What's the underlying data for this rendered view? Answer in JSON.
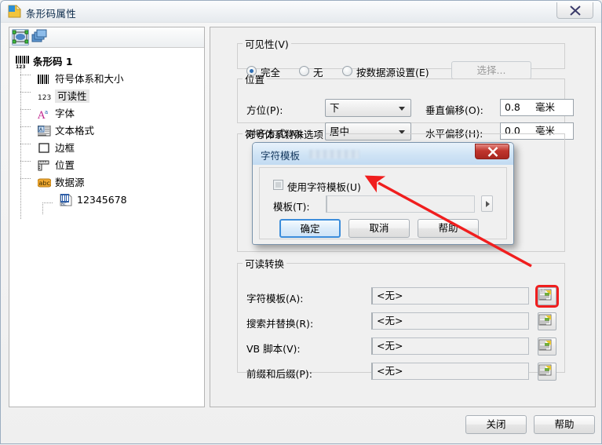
{
  "window": {
    "title": "条形码属性",
    "icon": "document-page-icon",
    "close_label": "×"
  },
  "tree_toolbar": {
    "buttons": [
      {
        "name": "object-select-icon",
        "pressed": true
      },
      {
        "name": "layers-icon",
        "pressed": false
      }
    ]
  },
  "tree": {
    "root": {
      "label": "条形码 1",
      "icon": "barcode-123-icon"
    },
    "items": [
      {
        "label": "符号体系和大小",
        "icon": "barcode-icon"
      },
      {
        "label": "可读性",
        "icon": "digits-123-icon",
        "selected": true
      },
      {
        "label": "字体",
        "icon": "font-a-icon"
      },
      {
        "label": "文本格式",
        "icon": "text-format-icon"
      },
      {
        "label": "边框",
        "icon": "border-square-icon"
      },
      {
        "label": "位置",
        "icon": "ruler-position-icon"
      },
      {
        "label": "数据源",
        "icon": "abc-datasource-icon"
      }
    ],
    "leaf": {
      "label": "12345678",
      "icon": "barcode-data-icon"
    }
  },
  "visibility": {
    "legend": "可见性(V)",
    "options": [
      {
        "label": "完全",
        "selected": true
      },
      {
        "label": "无",
        "selected": false
      },
      {
        "label": "按数据源设置(E)",
        "selected": false
      }
    ],
    "select_button": "选择...",
    "select_button_disabled": true
  },
  "position": {
    "legend": "位置",
    "orientation_label": "方位(P):",
    "orientation_value": "下",
    "align_label": "对齐方式(A):",
    "align_value": "居中",
    "voffset_label": "垂直偏移(O):",
    "voffset_value": "0.8",
    "voffset_unit": "毫米",
    "hoffset_label": "水平偏移(H):",
    "hoffset_value": "0.0",
    "hoffset_unit": "毫米"
  },
  "symbology": {
    "legend": "符号体系特殊选项"
  },
  "conversion": {
    "legend": "可读转换",
    "rows": [
      {
        "label": "字符模板(A):",
        "value": "<无>",
        "browse_icon": "browse-script-icon",
        "highlighted": true
      },
      {
        "label": "搜索并替换(R):",
        "value": "<无>",
        "browse_icon": "browse-script-icon",
        "highlighted": false
      },
      {
        "label": "VB 脚本(V):",
        "value": "<无>",
        "browse_icon": "browse-script-icon",
        "highlighted": false
      },
      {
        "label": "前缀和后缀(P):",
        "value": "<无>",
        "browse_icon": "browse-script-icon",
        "highlighted": false
      }
    ]
  },
  "footer": {
    "close_label": "关闭",
    "help_label": "帮助"
  },
  "dialog": {
    "title": "字符模板",
    "close_label": "×",
    "checkbox_label": "使用字符模板(U)",
    "checkbox_checked": false,
    "template_label": "模板(T):",
    "template_value": "",
    "expand_icon": "expand-arrow-icon",
    "ok_label": "确定",
    "cancel_label": "取消",
    "help_label": "帮助"
  },
  "annotation": {
    "arrow_color": "#f01e1e",
    "highlight_color": "#f01e1e"
  }
}
